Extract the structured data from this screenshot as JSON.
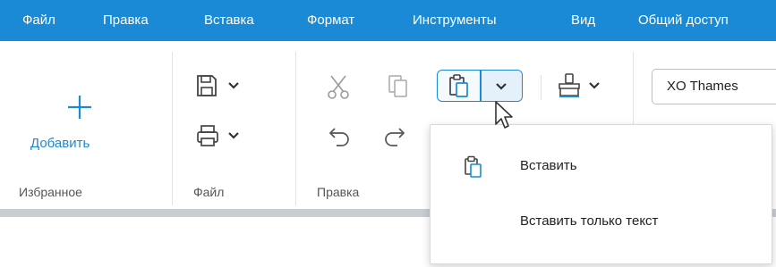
{
  "menubar": {
    "items": [
      "Файл",
      "Правка",
      "Вставка",
      "Формат",
      "Инструменты",
      "Вид",
      "Общий доступ"
    ]
  },
  "toolbar": {
    "add_label": "Добавить",
    "groups": [
      "Избранное",
      "Файл",
      "Правка"
    ],
    "font_name": "XO Thames"
  },
  "paste_menu": {
    "items": [
      "Вставить",
      "Вставить только текст"
    ]
  },
  "icons": {
    "add": "plus-icon",
    "save": "save-icon",
    "print": "print-icon",
    "cut": "scissors-icon",
    "copy": "copy-icon",
    "paste": "paste-icon",
    "undo": "undo-icon",
    "redo": "redo-icon",
    "format_painter": "brush-icon",
    "chevron": "chevron-down-icon",
    "cursor": "mouse-cursor-icon"
  },
  "colors": {
    "accent": "#1a8ad6",
    "menubar_text": "#ffffff"
  }
}
